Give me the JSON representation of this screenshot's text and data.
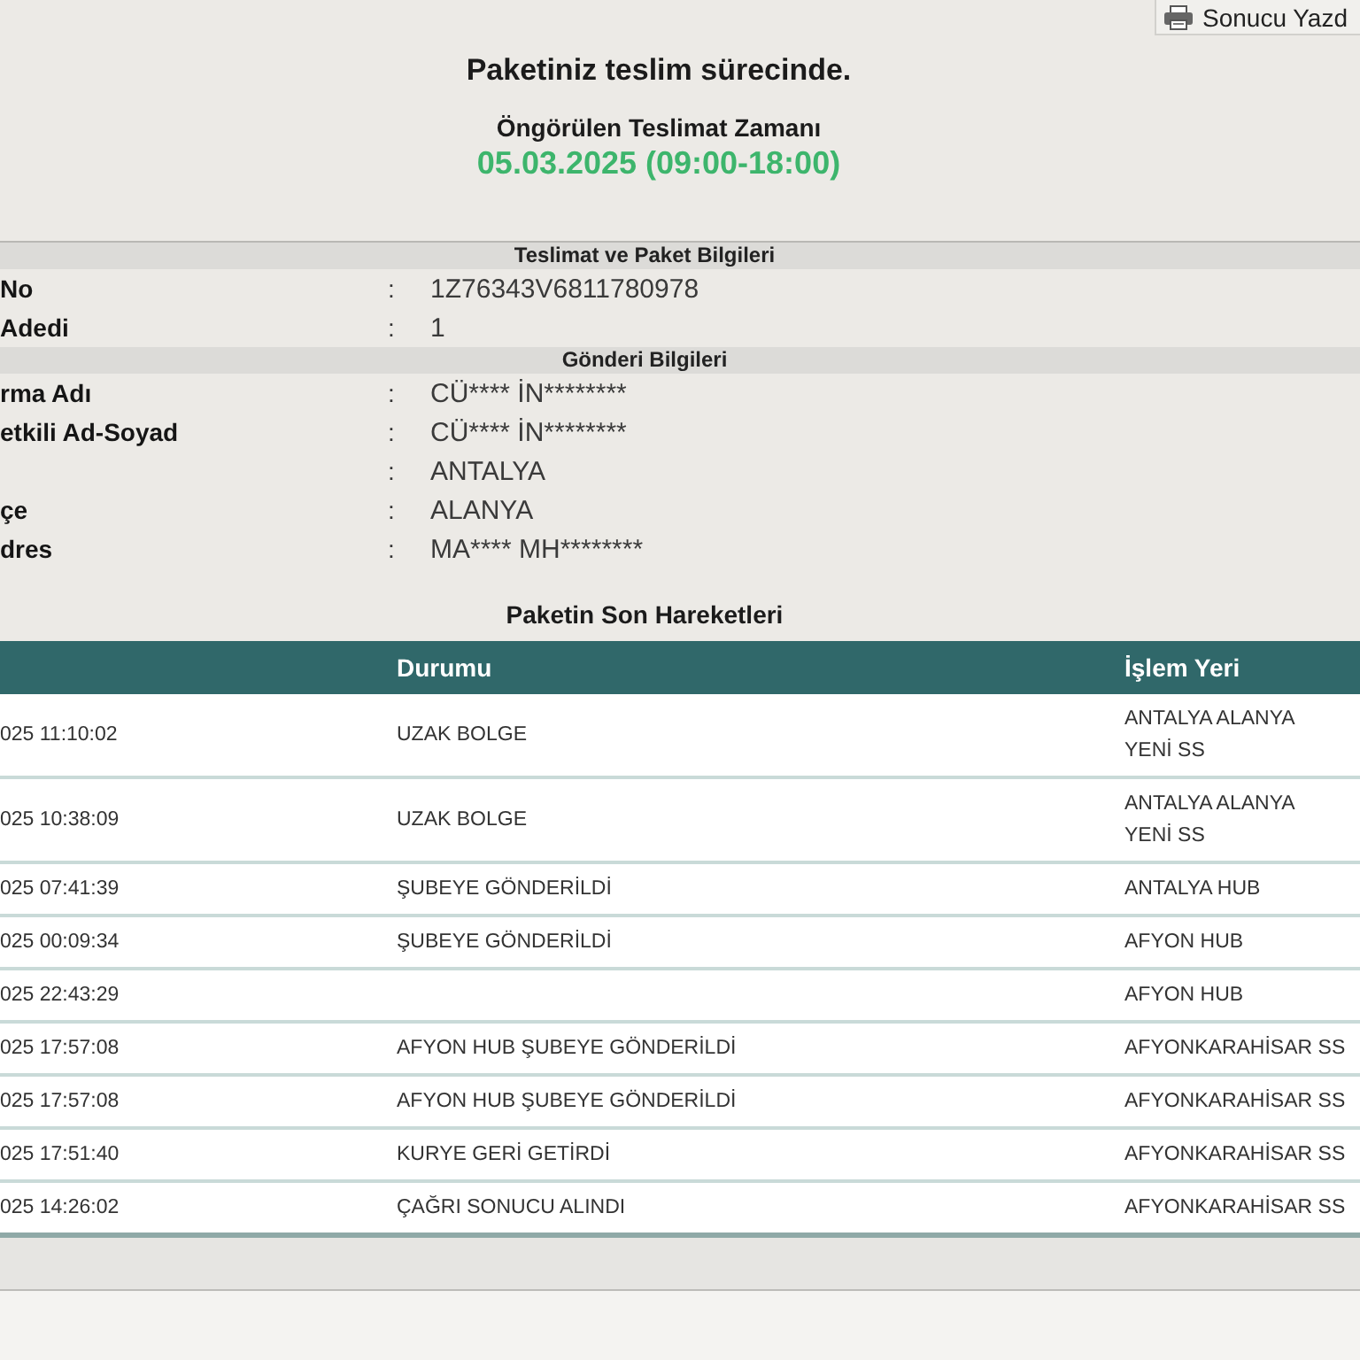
{
  "print_button": {
    "label": "Sonucu Yazd"
  },
  "status": {
    "title": "Paketiniz teslim sürecinde.",
    "eta_label": "Öngörülen Teslimat Zamanı",
    "eta_value": "05.03.2025 (09:00-18:00)"
  },
  "sections": [
    {
      "title": "Teslimat ve Paket Bilgileri",
      "fields": [
        {
          "label": "No",
          "colon": ":",
          "value": "1Z76343V6811780978"
        },
        {
          "label": "Adedi",
          "colon": ":",
          "value": "1"
        }
      ]
    },
    {
      "title": "Gönderi Bilgileri",
      "fields": [
        {
          "label": "rma Adı",
          "colon": ":",
          "value": "CÜ**** İN********"
        },
        {
          "label": "etkili Ad-Soyad",
          "colon": ":",
          "value": "CÜ**** İN********"
        },
        {
          "colon": ":",
          "value": "ANTALYA"
        },
        {
          "label": "çe",
          "colon": ":",
          "value": "ALANYA"
        },
        {
          "label": "dres",
          "colon": ":",
          "value": "MA**** MH********"
        }
      ]
    }
  ],
  "movements": {
    "title": "Paketin Son Hareketleri",
    "columns": [
      {
        "label": "Durumu"
      },
      {
        "label": "İşlem Yeri"
      }
    ],
    "rows": [
      {
        "date": "025 11:10:02",
        "status": "UZAK BOLGE",
        "place": "ANTALYA ALANYA\nYENİ SS"
      },
      {
        "date": "025 10:38:09",
        "status": "UZAK BOLGE",
        "place": "ANTALYA ALANYA\nYENİ SS"
      },
      {
        "date": "025 07:41:39",
        "status": "ŞUBEYE GÖNDERİLDİ",
        "place": "ANTALYA HUB"
      },
      {
        "date": "025 00:09:34",
        "status": "ŞUBEYE GÖNDERİLDİ",
        "place": "AFYON HUB"
      },
      {
        "date": "025 22:43:29",
        "place": "AFYON HUB"
      },
      {
        "date": "025 17:57:08",
        "status": "AFYON HUB ŞUBEYE GÖNDERİLDİ",
        "place": "AFYONKARAHİSAR SS"
      },
      {
        "date": "025 17:57:08",
        "status": "AFYON HUB ŞUBEYE GÖNDERİLDİ",
        "place": "AFYONKARAHİSAR SS"
      },
      {
        "date": "025 17:51:40",
        "status": "KURYE GERİ GETİRDİ",
        "place": "AFYONKARAHİSAR SS"
      },
      {
        "date": "025 14:26:02",
        "status": "ÇAĞRI SONUCU ALINDI",
        "place": "AFYONKARAHİSAR SS"
      }
    ]
  }
}
